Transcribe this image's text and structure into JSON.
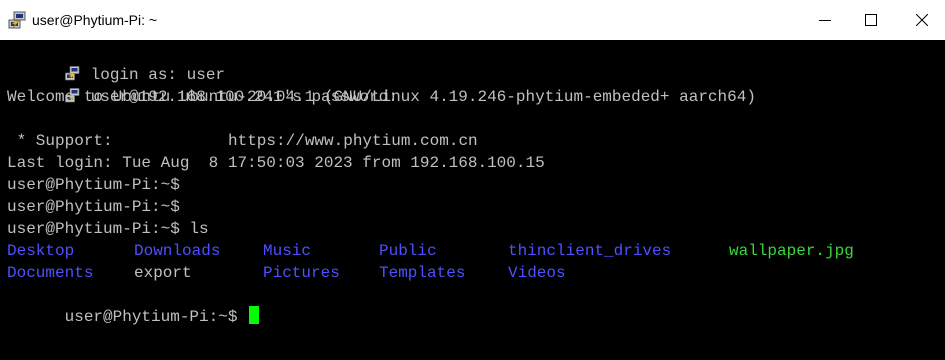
{
  "window": {
    "title": "user@Phytium-Pi: ~",
    "icon": "putty-icon"
  },
  "controls": {
    "minimize": "minimize-icon",
    "maximize": "maximize-icon",
    "close": "close-icon"
  },
  "terminal": {
    "login_line": "login as: user",
    "password_line": "user@192.168.100.241's password:",
    "welcome_line": "Welcome to Ubuntu ubuntu-20.04.1 (GNU/Linux 4.19.246-phytium-embeded+ aarch64)",
    "support_label": " * Support:",
    "support_url": "https://www.phytium.com.cn",
    "last_login": "Last login: Tue Aug  8 17:50:03 2023 from 192.168.100.15",
    "prompt1": "user@Phytium-Pi:~$",
    "prompt2": "user@Phytium-Pi:~$",
    "prompt3": "user@Phytium-Pi:~$ ls",
    "ls_row1": [
      "Desktop",
      "Downloads",
      "Music",
      "Public",
      "thinclient_drives",
      "wallpaper.jpg"
    ],
    "ls_row2": [
      "Documents",
      "export",
      "Pictures",
      "Templates",
      "Videos"
    ],
    "prompt4": "user@Phytium-Pi:~$ "
  },
  "colors": {
    "background": "#000000",
    "text": "#c0c0c0",
    "directory": "#4f4fff",
    "image_file": "#3ad83a",
    "cursor": "#00ff00"
  }
}
